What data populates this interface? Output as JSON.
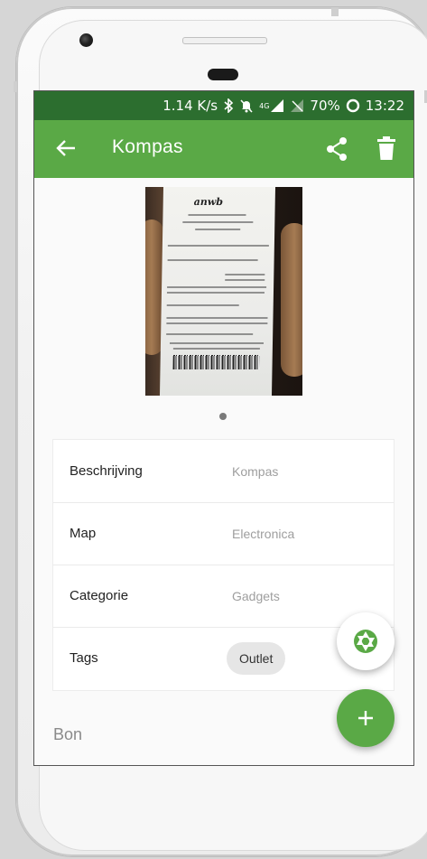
{
  "status_bar": {
    "network_speed": "1.14 K/s",
    "network_type": "4G",
    "battery": "70%",
    "time": "13:22",
    "icons": [
      "bluetooth-icon",
      "mute-icon",
      "signal-icon",
      "no-sim-icon",
      "battery-icon"
    ]
  },
  "app_bar": {
    "title": "Kompas",
    "back_icon": "arrow-left-icon",
    "share_icon": "share-icon",
    "delete_icon": "trash-icon"
  },
  "receipt_photo": {
    "logo_text": "anwb",
    "description": "receipt-image"
  },
  "pager": {
    "current": 1,
    "total": 1
  },
  "details": {
    "rows": [
      {
        "label": "Beschrijving",
        "value": "Kompas"
      },
      {
        "label": "Map",
        "value": "Electronica"
      },
      {
        "label": "Categorie",
        "value": "Gadgets"
      },
      {
        "label": "Tags",
        "tag": "Outlet"
      }
    ]
  },
  "section": {
    "bon_label": "Bon"
  },
  "fabs": {
    "camera_icon": "aperture-icon",
    "add_icon": "plus-icon"
  },
  "colors": {
    "status_bar": "#2c6e2f",
    "app_bar": "#5aa946",
    "accent": "#5aa946",
    "chip": "#e6e6e6"
  }
}
